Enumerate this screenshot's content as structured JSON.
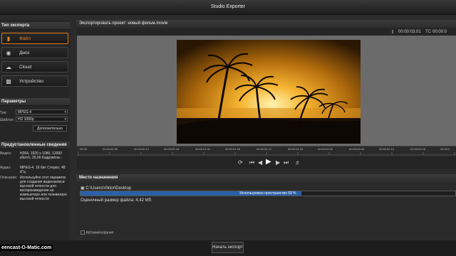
{
  "window": {
    "title": "Studio Exporter"
  },
  "left": {
    "export_type_title": "Тип экспорта",
    "nav": [
      {
        "label": "Файл",
        "icon": "file-icon",
        "active": true
      },
      {
        "label": "Диск",
        "icon": "disc-icon",
        "active": false
      },
      {
        "label": "Cloud",
        "icon": "cloud-icon",
        "active": false
      },
      {
        "label": "Устройство",
        "icon": "device-icon",
        "active": false
      }
    ],
    "params_title": "Параметры",
    "type_label": "Тип:",
    "type_value": "MPEG-4",
    "template_label": "Шаблон:",
    "template_value": "HD 1080p",
    "more_button": "Дополнительно",
    "preset_title": "Предустановленные сведения",
    "video_label": "Видео:",
    "video_value": "H264, 1920 x 1080, 12000 кбит/с; 25,00 Кадров/сек.",
    "audio_label": "Аудио:",
    "audio_value": "MPEG-4, 16 бит Стерео, 48 кГц",
    "desc_label": "Описание:",
    "desc_value": "Используйте этот параметр для создания видеозаписи высокой четкости для воспроизведения на компьютере или телевизоре высокой четкости"
  },
  "main": {
    "header": "Экспортировать проект: новый фильм.movie",
    "timecode": "00:00:03.01",
    "tc_label": "TC",
    "tc_value": "00:00:0",
    "ruler_ticks": [
      "00.00",
      "00:00:00.06",
      "00:00:00.12",
      "00:00:00.18",
      "00:00:01.00",
      "00:00:01.06",
      "00:00:01.12",
      "00:00:01.18",
      "00:00:02.00",
      "00:00:02.06",
      "00:00:02.12",
      "00:00:02.18",
      "00:00:0"
    ]
  },
  "destination": {
    "title": "Место назначения",
    "folder": "C:\\Users\\Viktor\\Desktop",
    "used_space_text": "Используемое пространство 59 %",
    "used_space_fraction": 0.59,
    "est_size": "Оценочный размер файла: 4,42 Мб",
    "autoname": "Автоименование"
  },
  "footer": {
    "export_button": "Начать экспорт"
  },
  "watermark": "eencast-O-Matic.com"
}
